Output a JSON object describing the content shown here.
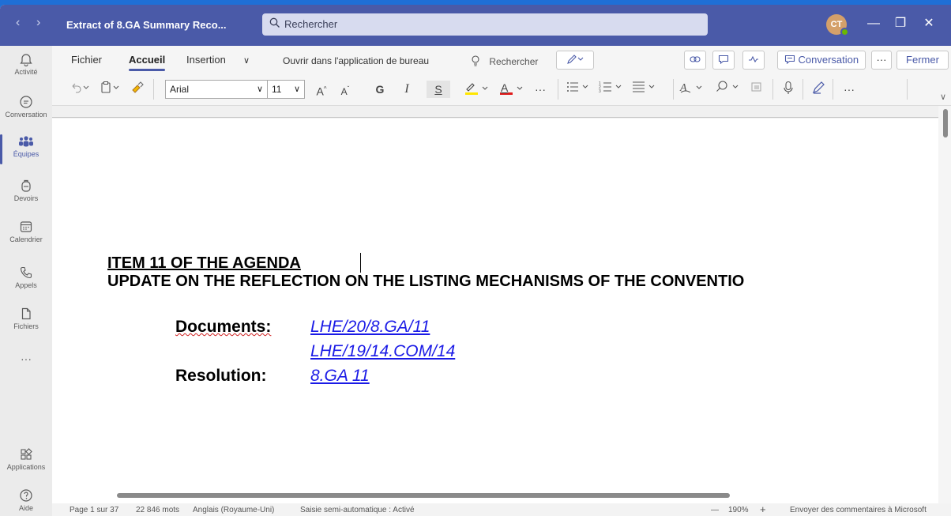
{
  "titlebar": {
    "back": "‹",
    "forward": "›",
    "doc_title": "Extract of 8.GA Summary Reco...",
    "search_placeholder": "Rechercher",
    "avatar_initials": "CT",
    "minimize": "—",
    "maximize": "❐",
    "close": "✕"
  },
  "rail": {
    "items": [
      {
        "label": "Activité",
        "icon": "bell-icon"
      },
      {
        "label": "Conversation",
        "icon": "chat-icon"
      },
      {
        "label": "Équipes",
        "icon": "teams-icon",
        "active": true
      },
      {
        "label": "Devoirs",
        "icon": "backpack-icon"
      },
      {
        "label": "Calendrier",
        "icon": "calendar-icon"
      },
      {
        "label": "Appels",
        "icon": "phone-icon"
      },
      {
        "label": "Fichiers",
        "icon": "file-icon"
      },
      {
        "label": "...",
        "icon": "more-icon"
      },
      {
        "label": "Applications",
        "icon": "apps-icon"
      },
      {
        "label": "Aide",
        "icon": "help-icon"
      }
    ],
    "more": "···"
  },
  "ribbon": {
    "tabs": [
      "Fichier",
      "Accueil",
      "Insertion"
    ],
    "tabs_more": "∨",
    "open_desktop": "Ouvrir dans l'application de bureau",
    "tell_me": "Rechercher",
    "conversation": "Conversation",
    "more_dots": "···",
    "close": "Fermer",
    "font_name": "Arial",
    "font_size": "11",
    "grow": "A",
    "shrink": "A",
    "bold": "G",
    "italic": "I",
    "underline": "S",
    "font_color": "A",
    "ellipsis": "···"
  },
  "document": {
    "heading1": "ITEM 11 OF THE AGENDA",
    "heading2": "UPDATE ON THE REFLECTION ON THE LISTING MECHANISMS OF THE CONVENTIO",
    "documents_label": "Documents:",
    "doc_link_1": "LHE/20/8.GA/11",
    "doc_link_2": "LHE/19/14.COM/14",
    "resolution_label": "Resolution:",
    "resolution_link": "8.GA 11"
  },
  "status": {
    "page": "Page 1 sur 37",
    "words": "22 846 mots",
    "language": "Anglais (Royaume-Uni)",
    "autocomplete": "Saisie semi-automatique : Activé",
    "zoom_out": "—",
    "zoom": "190%",
    "zoom_in": "+",
    "feedback": "Envoyer des commentaires à Microsoft"
  },
  "colors": {
    "titlebar": "#4a5aa8",
    "accent": "#4a5aa8",
    "link": "#1a1ae6",
    "highlight": "#ffe600",
    "font_color_bar": "#e01b1b"
  }
}
